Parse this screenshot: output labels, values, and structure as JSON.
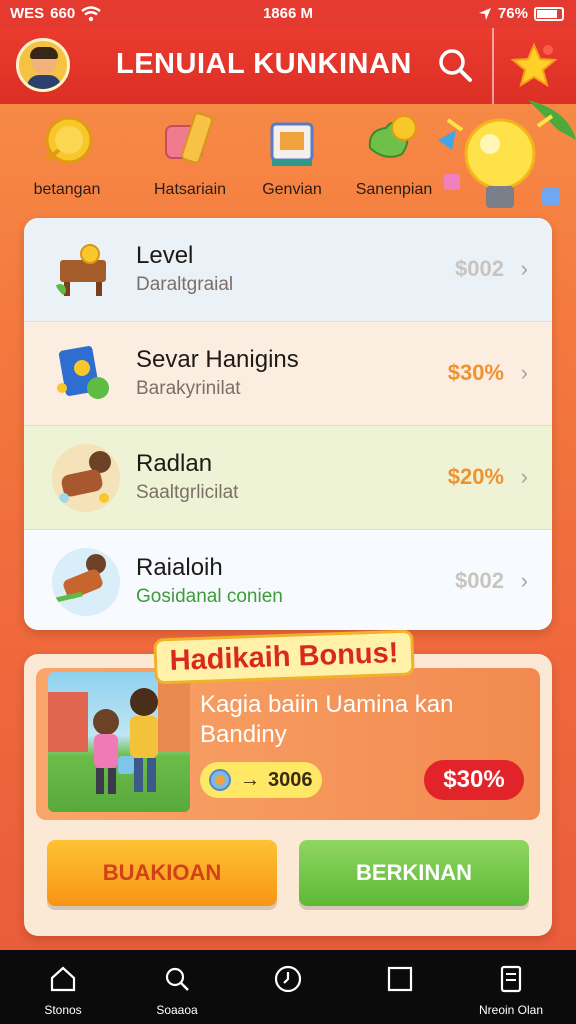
{
  "status_bar": {
    "carrier": "WES",
    "signal_text": "660",
    "time": "1866 M",
    "battery": "76%"
  },
  "header": {
    "title": "LENUIAL KUNKINAN",
    "avatar_icon": "user-avatar",
    "search_icon": "search-icon",
    "favorite_icon": "star-icon"
  },
  "categories": [
    {
      "label": "betangan",
      "icon": "coin-icon"
    },
    {
      "label": "Hatsariain",
      "icon": "ticket-icon"
    },
    {
      "label": "Genvian",
      "icon": "box-icon"
    },
    {
      "label": "Sanenpian",
      "icon": "coin-stack-icon"
    }
  ],
  "list": [
    {
      "title": "Level",
      "subtitle": "Daraltgraial",
      "price": "$002",
      "price_color": "#c9c4be",
      "subtitle_color": "#7b7068",
      "bg": "#eaf1f7"
    },
    {
      "title": "Sevar Hanigins",
      "subtitle": "Barakyrinilat",
      "price": "$30%",
      "price_color": "#f0922f",
      "subtitle_color": "#7b7068",
      "bg": "#fbeee0"
    },
    {
      "title": "Radlan",
      "subtitle": "Saaltgrlicilat",
      "price": "$20%",
      "price_color": "#f0922f",
      "subtitle_color": "#7b7068",
      "bg": "#eef3d6"
    },
    {
      "title": "Raialoih",
      "subtitle": "Gosidanal conien",
      "price": "$002",
      "price_color": "#c9c4be",
      "subtitle_color": "#3f9a3a",
      "bg": "#f7fbff"
    }
  ],
  "bonus": {
    "ribbon": "Hadikaih Bonus!",
    "title": "Kagia baiin Uamina kan Bandiny",
    "coins": "3006",
    "coin_prefix": "→",
    "percent": "$30%"
  },
  "buttons": {
    "left": "BUAKIOAN",
    "right": "BERKINAN"
  },
  "bottom_nav": [
    {
      "label": "Stonos",
      "icon": "home-icon"
    },
    {
      "label": "Soaaoa",
      "icon": "search-icon"
    },
    {
      "label": "",
      "icon": "clock-icon"
    },
    {
      "label": "",
      "icon": "square-icon"
    },
    {
      "label": "Nreoin Olan",
      "icon": "document-icon"
    }
  ]
}
